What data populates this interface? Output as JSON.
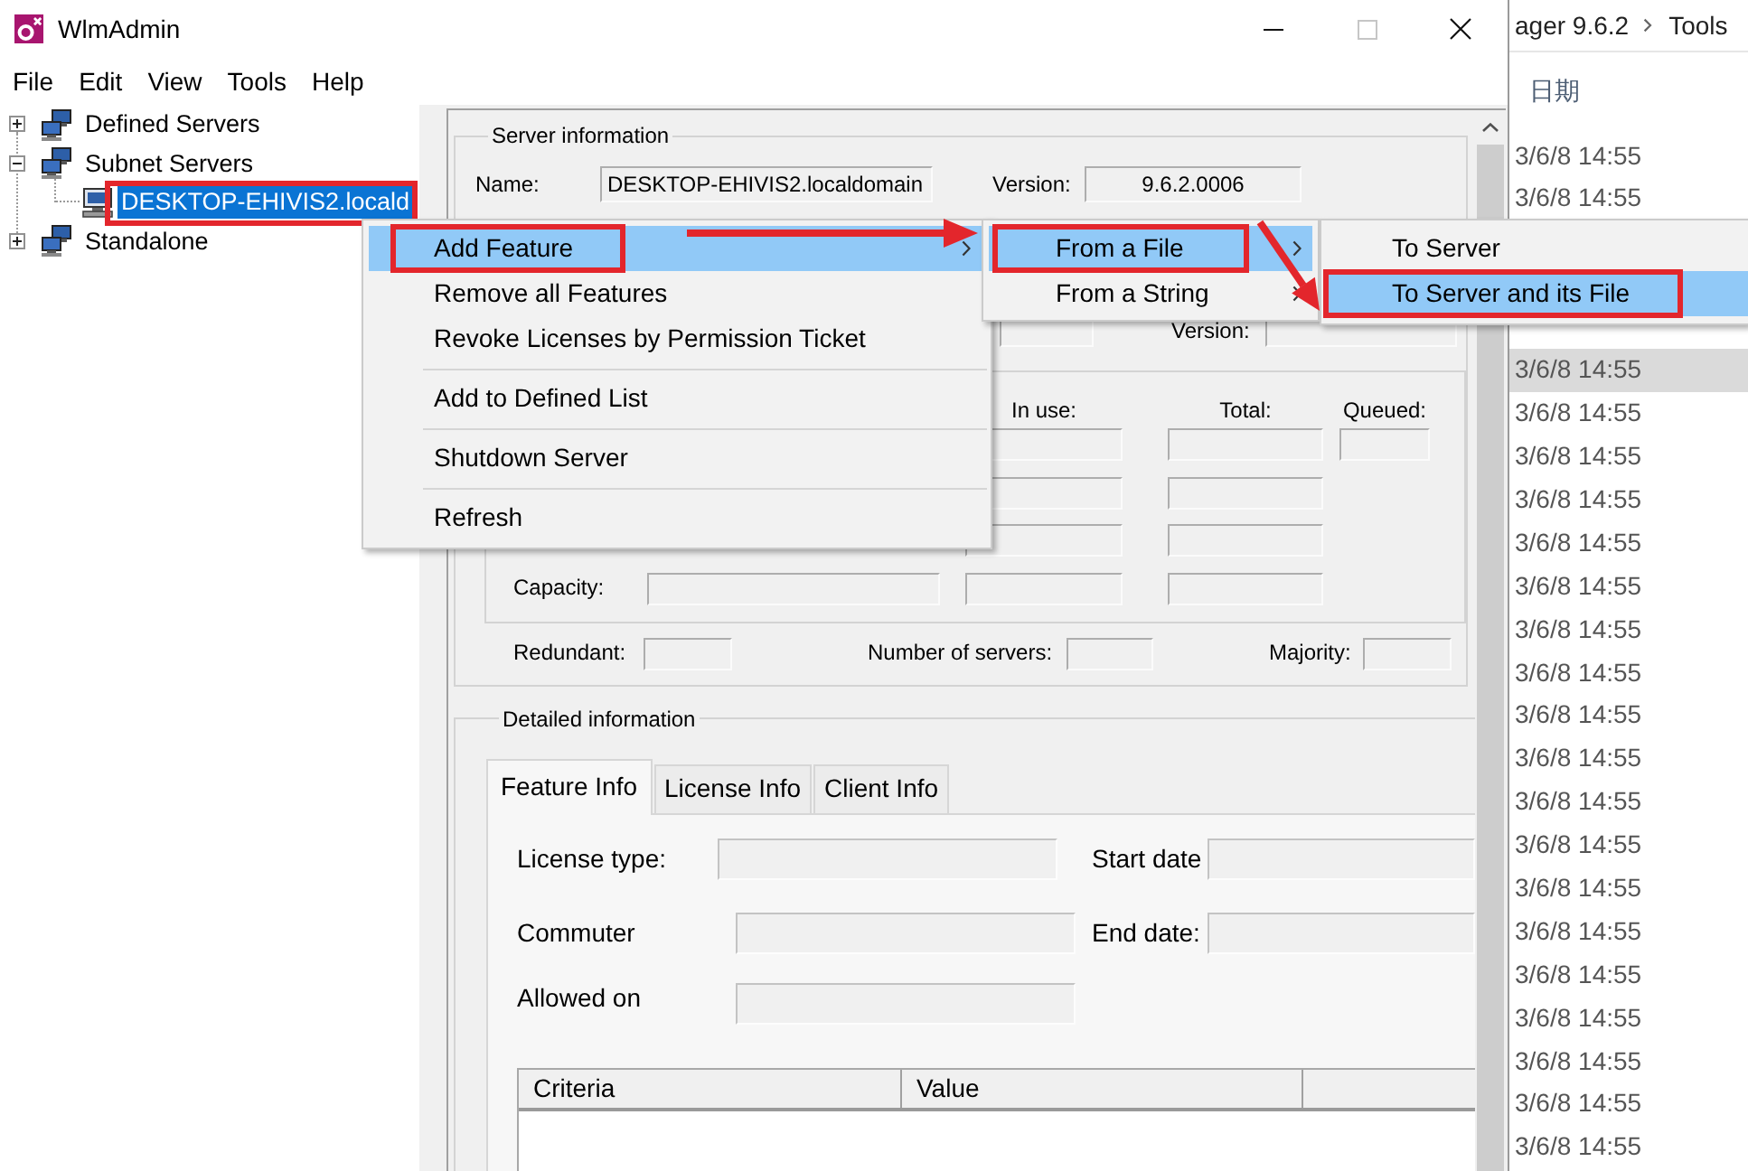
{
  "window": {
    "title": "WlmAdmin",
    "controls": [
      {
        "kind": "minimize",
        "disabled": false
      },
      {
        "kind": "maximize",
        "disabled": true
      },
      {
        "kind": "close",
        "disabled": false
      }
    ]
  },
  "menu_bar": [
    "File",
    "Edit",
    "View",
    "Tools",
    "Help"
  ],
  "tree": [
    {
      "kind": "group",
      "label": "Defined Servers",
      "expanded": false,
      "selected": false,
      "marked": false
    },
    {
      "kind": "group",
      "label": "Subnet Servers",
      "expanded": true,
      "selected": false,
      "marked": false,
      "children": [
        {
          "kind": "server",
          "label": "DESKTOP-EHIVIS2.locald",
          "selected": true,
          "marked": true
        }
      ]
    },
    {
      "kind": "group",
      "label": "Standalone",
      "expanded": false,
      "selected": false,
      "marked": false
    }
  ],
  "server_info": {
    "legend": "Server information",
    "name_label": "Name:",
    "name": "DESKTOP-EHIVIS2.localdomain",
    "version_label": "Version:",
    "version": "9.6.2.0006",
    "second_version_label": "Version:"
  },
  "licenses": {
    "columns": [
      "In use:",
      "Total:",
      "Queued:"
    ],
    "capacity_label": "Capacity:"
  },
  "redundancy": [
    "Redundant:",
    "Number of servers:",
    "Majority:"
  ],
  "details": {
    "legend": "Detailed information",
    "tabs": [
      {
        "label": "Feature Info",
        "selected": true
      },
      {
        "label": "License Info",
        "selected": false
      },
      {
        "label": "Client Info",
        "selected": false
      }
    ],
    "rows": [
      [
        "License type:",
        "Start date"
      ],
      [
        "Commuter",
        "End date:"
      ],
      [
        "Allowed on"
      ]
    ],
    "table_columns": [
      "Criteria",
      "Value"
    ]
  },
  "context_menu": [
    {
      "kind": "item",
      "label": "Add Feature",
      "submenu": true,
      "selected": true,
      "marked": true
    },
    {
      "kind": "item",
      "label": "Remove all Features",
      "submenu": false,
      "selected": false,
      "marked": false
    },
    {
      "kind": "item",
      "label": "Revoke Licenses by Permission Ticket",
      "submenu": false,
      "selected": false,
      "marked": false
    },
    {
      "kind": "separator"
    },
    {
      "kind": "item",
      "label": "Add to Defined List",
      "submenu": false,
      "selected": false,
      "marked": false
    },
    {
      "kind": "separator"
    },
    {
      "kind": "item",
      "label": "Shutdown Server",
      "submenu": false,
      "selected": false,
      "marked": false
    },
    {
      "kind": "separator"
    },
    {
      "kind": "item",
      "label": "Refresh",
      "submenu": false,
      "selected": false,
      "marked": false
    }
  ],
  "submenu": [
    {
      "kind": "item",
      "label": "From a File",
      "submenu": true,
      "selected": true,
      "marked": true
    },
    {
      "kind": "item",
      "label": "From a String",
      "submenu": true,
      "selected": false,
      "marked": false
    }
  ],
  "submenu_2": [
    {
      "kind": "item",
      "label": "To Server",
      "submenu": false,
      "selected": false,
      "marked": false
    },
    {
      "kind": "item",
      "label": "To Server and its File",
      "submenu": false,
      "selected": true,
      "marked": true
    }
  ],
  "explorer": {
    "breadcrumb": [
      "ager 9.6.2",
      "Tools"
    ],
    "column": "日期",
    "rows": [
      {
        "modified": "3/6/8 14:55",
        "selected": false
      },
      {
        "modified": "3/6/8 14:55",
        "selected": false
      },
      {
        "modified": "3/6/8 14:55",
        "selected": true
      },
      {
        "modified": "3/6/8 14:55",
        "selected": false
      },
      {
        "modified": "3/6/8 14:55",
        "selected": false
      },
      {
        "modified": "3/6/8 14:55",
        "selected": false
      },
      {
        "modified": "3/6/8 14:55",
        "selected": false
      },
      {
        "modified": "3/6/8 14:55",
        "selected": false
      },
      {
        "modified": "3/6/8 14:55",
        "selected": false
      },
      {
        "modified": "3/6/8 14:55",
        "selected": false
      },
      {
        "modified": "3/6/8 14:55",
        "selected": false
      },
      {
        "modified": "3/6/8 14:55",
        "selected": false
      },
      {
        "modified": "3/6/8 14:55",
        "selected": false
      },
      {
        "modified": "3/6/8 14:55",
        "selected": false
      },
      {
        "modified": "3/6/8 14:55",
        "selected": false
      },
      {
        "modified": "3/6/8 14:55",
        "selected": false
      },
      {
        "modified": "3/6/8 14:55",
        "selected": false
      },
      {
        "modified": "3/6/8 14:55",
        "selected": false
      },
      {
        "modified": "3/6/8 14:55",
        "selected": false
      },
      {
        "modified": "3/6/8 14:55",
        "selected": false
      },
      {
        "modified": "3/6/8 14:55",
        "selected": false
      }
    ]
  }
}
